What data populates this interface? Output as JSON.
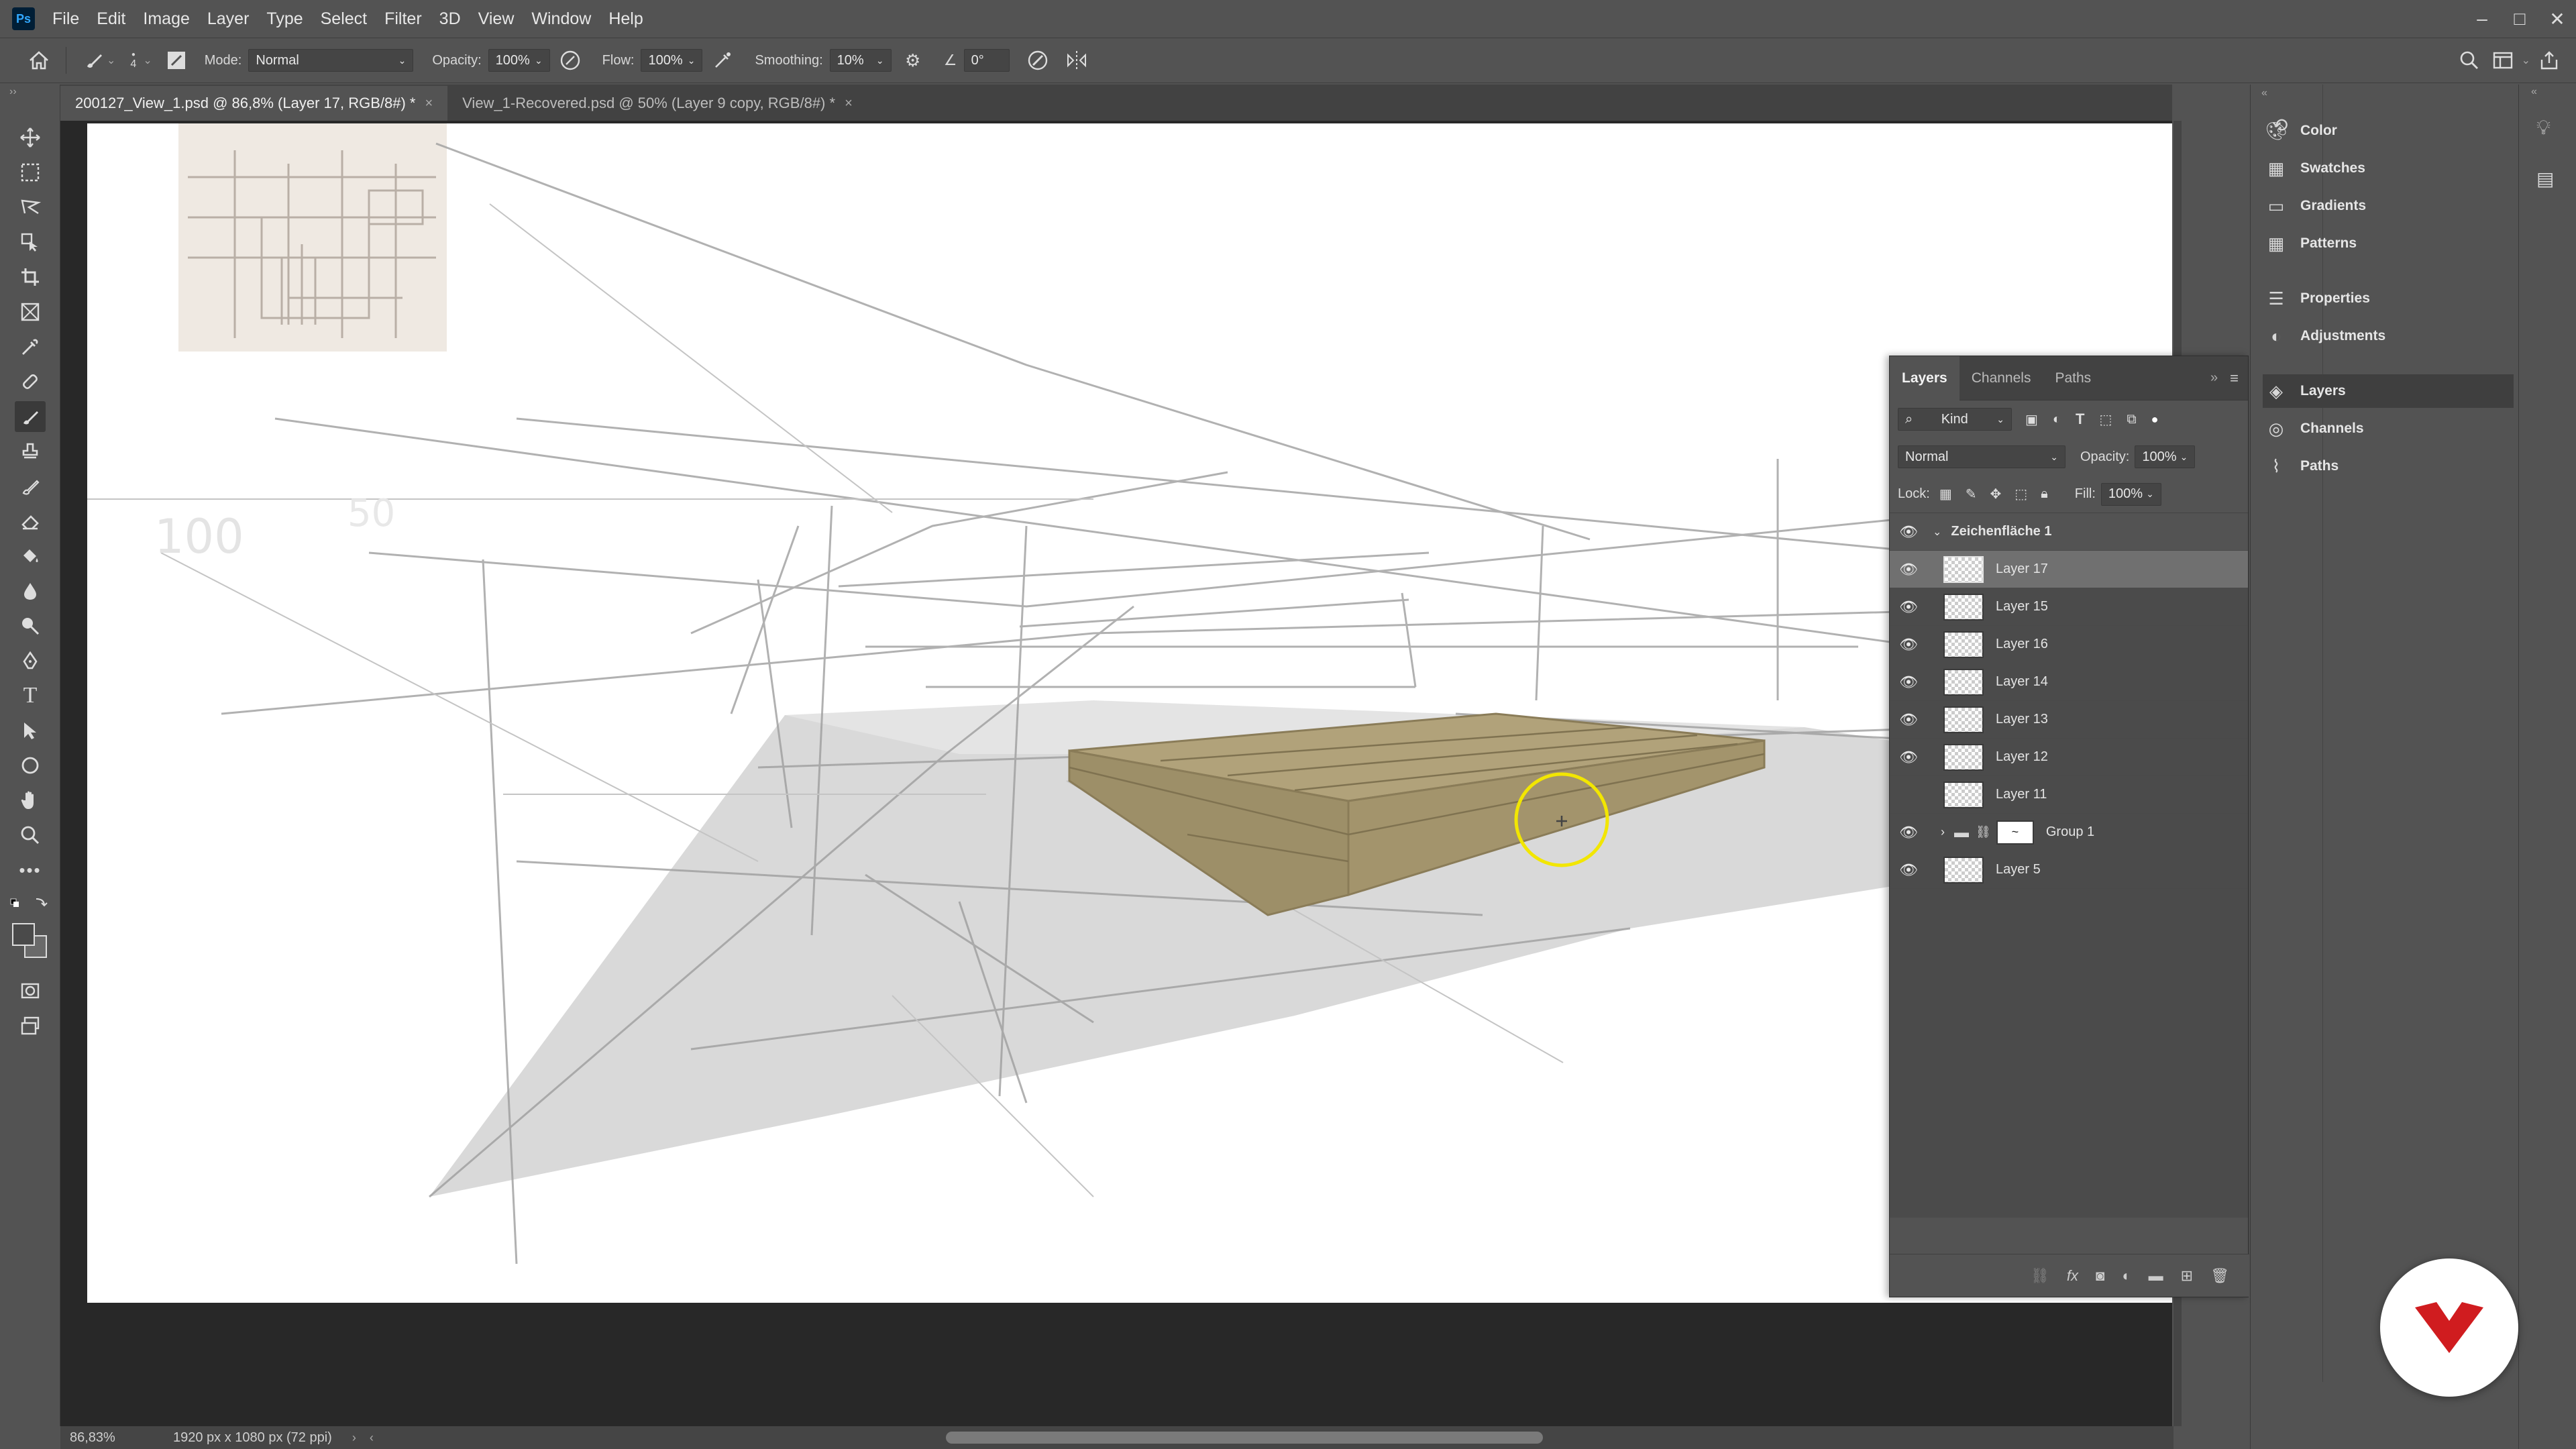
{
  "app": {
    "logo_text": "Ps"
  },
  "menu": [
    "File",
    "Edit",
    "Image",
    "Layer",
    "Type",
    "Select",
    "Filter",
    "3D",
    "View",
    "Window",
    "Help"
  ],
  "window_controls": {
    "minimize": "–",
    "maximize": "□",
    "close": "✕"
  },
  "options_bar": {
    "brush_size": "4",
    "mode_label": "Mode:",
    "mode_value": "Normal",
    "opacity_label": "Opacity:",
    "opacity_value": "100%",
    "flow_label": "Flow:",
    "flow_value": "100%",
    "smoothing_label": "Smoothing:",
    "smoothing_value": "10%",
    "angle_value": "0°"
  },
  "tabs": [
    {
      "label": "200127_View_1.psd @ 86,8% (Layer 17, RGB/8#) *",
      "close": "×"
    },
    {
      "label": "View_1-Recovered.psd @ 50% (Layer 9 copy, RGB/8#) *",
      "close": "×"
    }
  ],
  "layers_panel": {
    "tabs": [
      "Layers",
      "Channels",
      "Paths"
    ],
    "filter_kind": "Kind",
    "blend_mode": "Normal",
    "opacity_label": "Opacity:",
    "opacity_value": "100%",
    "lock_label": "Lock:",
    "fill_label": "Fill:",
    "fill_value": "100%",
    "artboard": "Zeichenfläche 1",
    "layers": [
      {
        "name": "Layer 17",
        "visible": true,
        "selected": true
      },
      {
        "name": "Layer 15",
        "visible": true
      },
      {
        "name": "Layer 16",
        "visible": true
      },
      {
        "name": "Layer 14",
        "visible": true
      },
      {
        "name": "Layer 13",
        "visible": true
      },
      {
        "name": "Layer 12",
        "visible": true
      },
      {
        "name": "Layer 11",
        "visible": false
      },
      {
        "name": "Group 1",
        "visible": true,
        "group": true
      },
      {
        "name": "Layer 5",
        "visible": true
      }
    ]
  },
  "right_dock": {
    "items": [
      "Color",
      "Swatches",
      "Gradients",
      "Patterns",
      "Properties",
      "Adjustments",
      "Layers",
      "Channels",
      "Paths"
    ]
  },
  "status": {
    "zoom": "86,83%",
    "doc_size": "1920 px x 1080 px (72 ppi)"
  },
  "colors": {
    "accent_highlight": "#f2e600",
    "wood": "#a89a72"
  }
}
